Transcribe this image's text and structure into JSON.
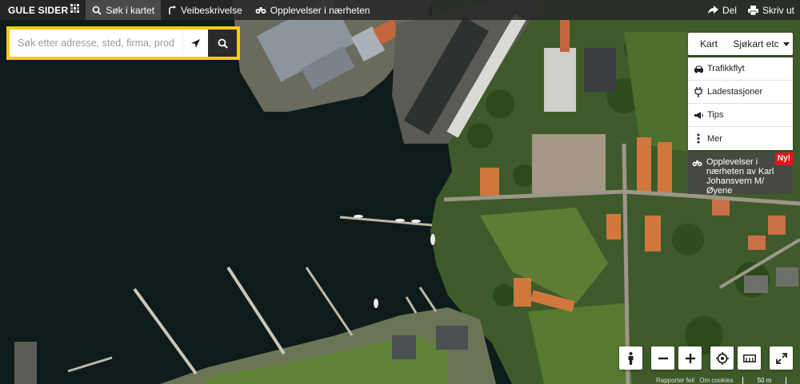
{
  "brand": {
    "name": "GULE SIDER",
    "mark_colors": [
      "#ffffff",
      "#9a9a9a",
      "#ffffff",
      "#9a9a9a",
      "#ffffff",
      "#9a9a9a",
      "#ffffff",
      "#9a9a9a",
      "#ffffff"
    ]
  },
  "nav": {
    "tabs": [
      {
        "label": "Søk i kartet",
        "icon": "search-icon",
        "active": true
      },
      {
        "label": "Veibeskrivelse",
        "icon": "route-icon",
        "active": false
      },
      {
        "label": "Opplevelser i nærheten",
        "icon": "binoculars-icon",
        "active": false
      }
    ],
    "share_label": "Del",
    "print_label": "Skriv ut"
  },
  "search": {
    "placeholder": "Søk etter adresse, sted, firma, produkt",
    "value": ""
  },
  "map_type": {
    "kart_label": "Kart",
    "selected_label": "Sjøkart etc"
  },
  "layers": [
    {
      "label": "Trafikkflyt",
      "icon": "car-icon"
    },
    {
      "label": "Ladestasjoner",
      "icon": "charging-plug-icon"
    },
    {
      "label": "Tips",
      "icon": "megaphone-icon"
    },
    {
      "label": "Mer",
      "icon": "more-dots-icon"
    }
  ],
  "promo": {
    "text": "Opplevelser i nærheten av Karl Johansvern M/Øyene",
    "badge": "Ny!"
  },
  "controls": [
    {
      "name": "street-view-button",
      "icon": "person-icon"
    },
    {
      "name": "zoom-out-button",
      "icon": "minus-icon"
    },
    {
      "name": "zoom-in-button",
      "icon": "plus-icon"
    },
    {
      "name": "locate-me-button",
      "icon": "crosshair-icon"
    },
    {
      "name": "measure-button",
      "icon": "ruler-icon"
    },
    {
      "name": "fullscreen-button",
      "icon": "expand-icon"
    }
  ],
  "attribution": {
    "report": "Rapporter feil",
    "about": "Om cookies"
  },
  "scale_label": "50 m",
  "colors": {
    "accent": "#f3cc16",
    "badge": "#e4161b",
    "topbar": "#282828"
  }
}
